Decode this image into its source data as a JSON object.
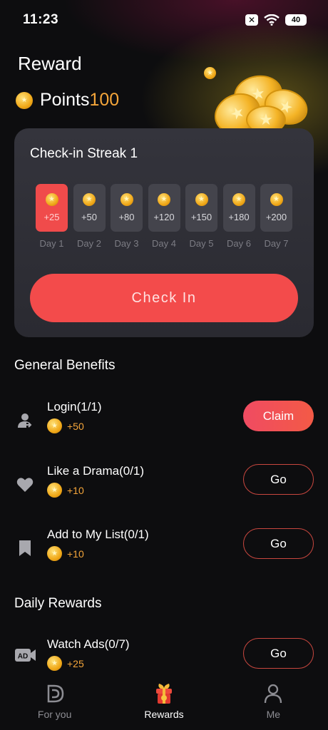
{
  "status_bar": {
    "time": "11:23",
    "battery": "40"
  },
  "page": {
    "title": "Reward"
  },
  "points": {
    "label": "Points",
    "value": "100"
  },
  "streak": {
    "title": "Check-in Streak 1",
    "days": [
      {
        "points": "+25",
        "label": "Day 1",
        "active": true
      },
      {
        "points": "+50",
        "label": "Day 2"
      },
      {
        "points": "+80",
        "label": "Day 3"
      },
      {
        "points": "+120",
        "label": "Day 4"
      },
      {
        "points": "+150",
        "label": "Day 5"
      },
      {
        "points": "+180",
        "label": "Day 6"
      },
      {
        "points": "+200",
        "label": "Day 7"
      }
    ],
    "button_label": "Check In"
  },
  "general_benefits": {
    "title": "General Benefits",
    "tasks": [
      {
        "name": "Login(1/1)",
        "reward": "+50",
        "action": "Claim",
        "icon": "user-login-icon"
      },
      {
        "name": "Like a Drama(0/1)",
        "reward": "+10",
        "action": "Go",
        "icon": "heart-icon"
      },
      {
        "name": "Add to My List(0/1)",
        "reward": "+10",
        "action": "Go",
        "icon": "bookmark-icon"
      }
    ]
  },
  "daily_rewards": {
    "title": "Daily Rewards",
    "tasks": [
      {
        "name": "Watch Ads(0/7)",
        "reward": "+25",
        "action": "Go",
        "icon": "ad-video-icon",
        "icon_text": "AD"
      }
    ]
  },
  "bottom_nav": {
    "items": [
      {
        "label": "For you",
        "icon": "logo-d-icon"
      },
      {
        "label": "Rewards",
        "icon": "gift-box-icon",
        "active": true
      },
      {
        "label": "Me",
        "icon": "person-icon"
      }
    ]
  },
  "colors": {
    "accent": "#f34b4b",
    "points": "#f4a53a",
    "card": "#2f2f36",
    "background": "#0d0d0f"
  }
}
